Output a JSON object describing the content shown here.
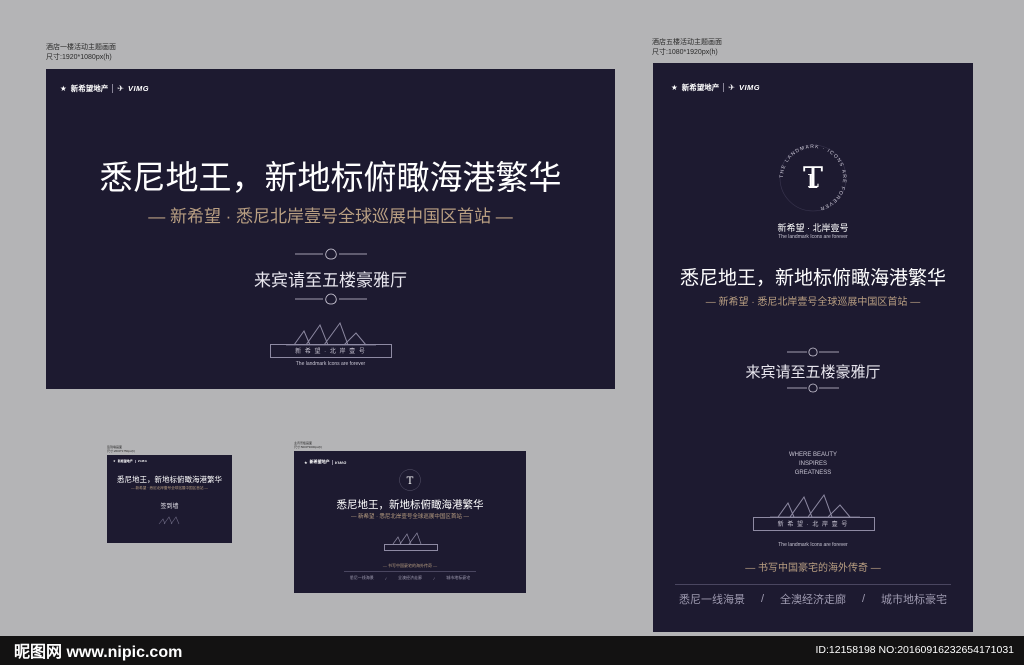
{
  "captions": {
    "main_title": "酒店一楼活动主题画面",
    "main_size": "尺寸:1920*1080px(h)",
    "tall_title": "酒店五楼活动主题画面",
    "tall_size": "尺寸:1080*1920px(h)",
    "small1_title": "签到墙画面",
    "small1_size": "尺寸:2600*1750px(h)",
    "small2_title": "主背景板画面",
    "small2_size": "尺寸:5000*3000px(h)"
  },
  "logo": {
    "brand1": "新希望地产",
    "brand2": "VIMG"
  },
  "content": {
    "headline": "悉尼地王，新地标俯瞰海港繁华",
    "subline": "— 新希望 · 悉尼北岸壹号全球巡展中国区首站 —",
    "invite": "来宾请至五楼豪雅厅",
    "project_name": "新 希 望 · 北 岸 壹 号",
    "project_name_compact": "新希望 · 北岸壹号",
    "tagline_en": "The landmark Icons are forever",
    "seal_text": "THE LANDMARK · ICONS ARE FOREVER",
    "slogan_lines": [
      "WHERE BEAUTY",
      "INSPIRES",
      "GREATNESS"
    ],
    "legend": "— 书写中国豪宅的海外传奇 —",
    "features": [
      "悉尼一线海景",
      "全澳经济走廊",
      "城市地标豪宅"
    ],
    "feature_sep": "/",
    "signin": "签到墙"
  },
  "watermark": {
    "site": "昵图网 www.nipic.com",
    "id": "ID:12158198 NO:20160916232654171031"
  },
  "colors": {
    "board": "#1d1a30",
    "gold": "#b99f82",
    "frame": "#b4b4b6"
  }
}
